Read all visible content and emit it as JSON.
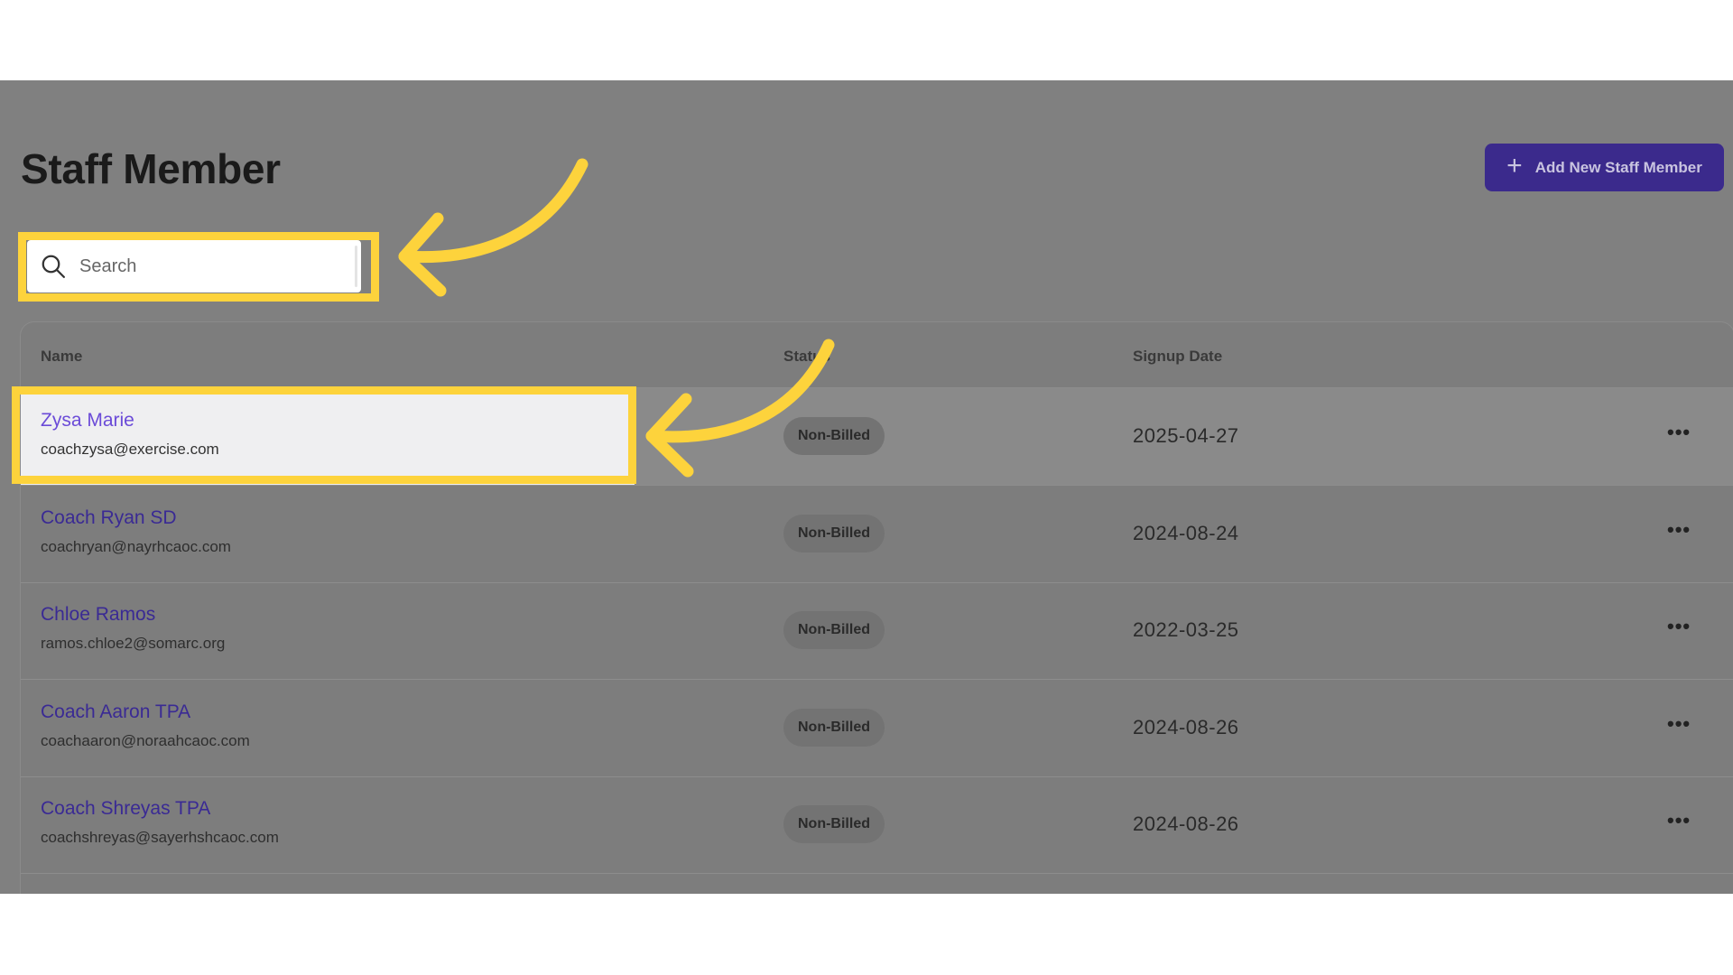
{
  "header": {
    "title": "Staff Member",
    "add_button_label": "Add New Staff Member",
    "add_button_icon": "plus-icon"
  },
  "search": {
    "placeholder": "Search",
    "value": "",
    "icon": "search-icon"
  },
  "table": {
    "columns": {
      "name": "Name",
      "status": "Status",
      "signup_date": "Signup Date"
    },
    "rows": [
      {
        "name": "Zysa Marie",
        "email": "coachzysa@exercise.com",
        "status": "Non-Billed",
        "signup_date": "2025-04-27",
        "actions": "•••"
      },
      {
        "name": "Coach Ryan SD",
        "email": "coachryan@nayrhcaoc.com",
        "status": "Non-Billed",
        "signup_date": "2024-08-24",
        "actions": "•••"
      },
      {
        "name": "Chloe Ramos",
        "email": "ramos.chloe2@somarc.org",
        "status": "Non-Billed",
        "signup_date": "2022-03-25",
        "actions": "•••"
      },
      {
        "name": "Coach Aaron TPA",
        "email": "coachaaron@noraahcaoc.com",
        "status": "Non-Billed",
        "signup_date": "2024-08-26",
        "actions": "•••"
      },
      {
        "name": "Coach Shreyas TPA",
        "email": "coachshreyas@sayerhshcaoc.com",
        "status": "Non-Billed",
        "signup_date": "2024-08-26",
        "actions": "•••"
      }
    ]
  },
  "colors": {
    "overlay": "#808080",
    "accent": "#3b2a8c",
    "link": "#3a2a94",
    "highlight": "#fdd33c"
  }
}
